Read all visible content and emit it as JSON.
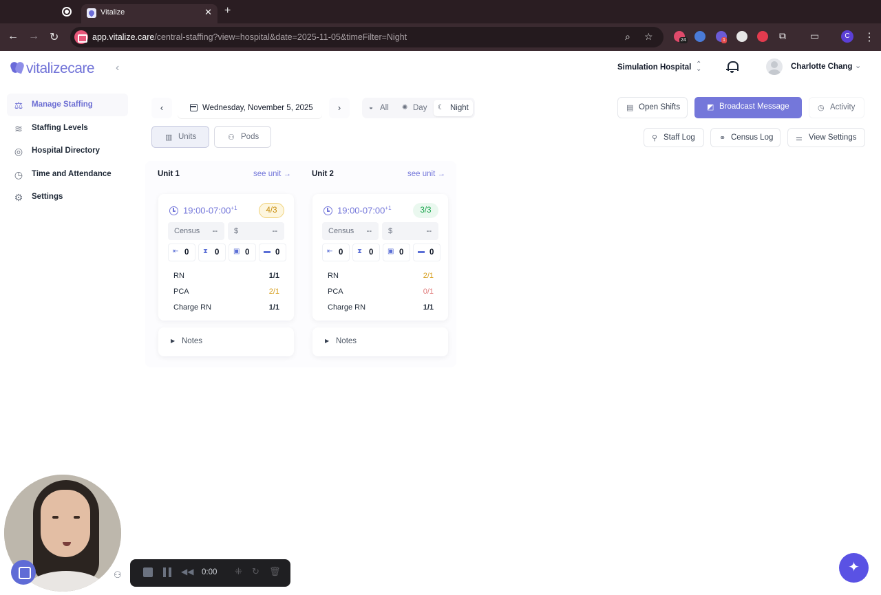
{
  "browser": {
    "tab_title": "Vitalize",
    "url_host": "app.vitalize.care",
    "url_path": "/central-staffing?view=hospital&date=2025-11-05&timeFilter=Night",
    "ext_badge_1": "24",
    "ext_badge_2": "1",
    "profile_initial": "C"
  },
  "app": {
    "logo_text": "vitalizecare",
    "hospital": "Simulation Hospital",
    "user_name": "Charlotte Chang"
  },
  "sidebar": {
    "items": [
      {
        "label": "Manage Staffing",
        "icon": "scale-icon",
        "active": true
      },
      {
        "label": "Staffing Levels",
        "icon": "levels-icon"
      },
      {
        "label": "Hospital Directory",
        "icon": "directory-icon"
      },
      {
        "label": "Time and Attendance",
        "icon": "clock-icon"
      },
      {
        "label": "Settings",
        "icon": "gear-icon"
      }
    ]
  },
  "controls": {
    "date": "Wednesday, November 5, 2025",
    "filters": [
      "All",
      "Day",
      "Night"
    ],
    "selected_filter": "Night",
    "views": [
      "Units",
      "Pods"
    ],
    "selected_view": "Units",
    "open_shifts": "Open Shifts",
    "broadcast": "Broadcast Message",
    "activity": "Activity",
    "staff_log": "Staff Log",
    "census_log": "Census Log",
    "view_settings": "View Settings"
  },
  "units": [
    {
      "name": "Unit 1",
      "see_unit": "see unit →",
      "shift": "19:00-07:00",
      "shift_sup": "+1",
      "ratio": "4/3",
      "census_label": "Census",
      "census_value": "--",
      "cost_label": "$",
      "cost_value": "--",
      "counts": [
        "0",
        "0",
        "0",
        "0"
      ],
      "roles": [
        {
          "role": "RN",
          "value": "1/1"
        },
        {
          "role": "PCA",
          "value": "2/1"
        },
        {
          "role": "Charge RN",
          "value": "1/1"
        }
      ],
      "notes": "Notes"
    },
    {
      "name": "Unit 2",
      "see_unit": "see unit →",
      "shift": "19:00-07:00",
      "shift_sup": "+1",
      "ratio": "3/3",
      "census_label": "Census",
      "census_value": "--",
      "cost_label": "$",
      "cost_value": "--",
      "counts": [
        "0",
        "0",
        "0",
        "0"
      ],
      "roles": [
        {
          "role": "RN",
          "value": "2/1"
        },
        {
          "role": "PCA",
          "value": "0/1"
        },
        {
          "role": "Charge RN",
          "value": "1/1"
        }
      ],
      "notes": "Notes"
    }
  ],
  "recorder": {
    "time": "0:00"
  },
  "colors": {
    "accent": "#7477da",
    "warn": "#d69e1c",
    "ok": "#16a34a",
    "danger": "#e07a7a"
  }
}
